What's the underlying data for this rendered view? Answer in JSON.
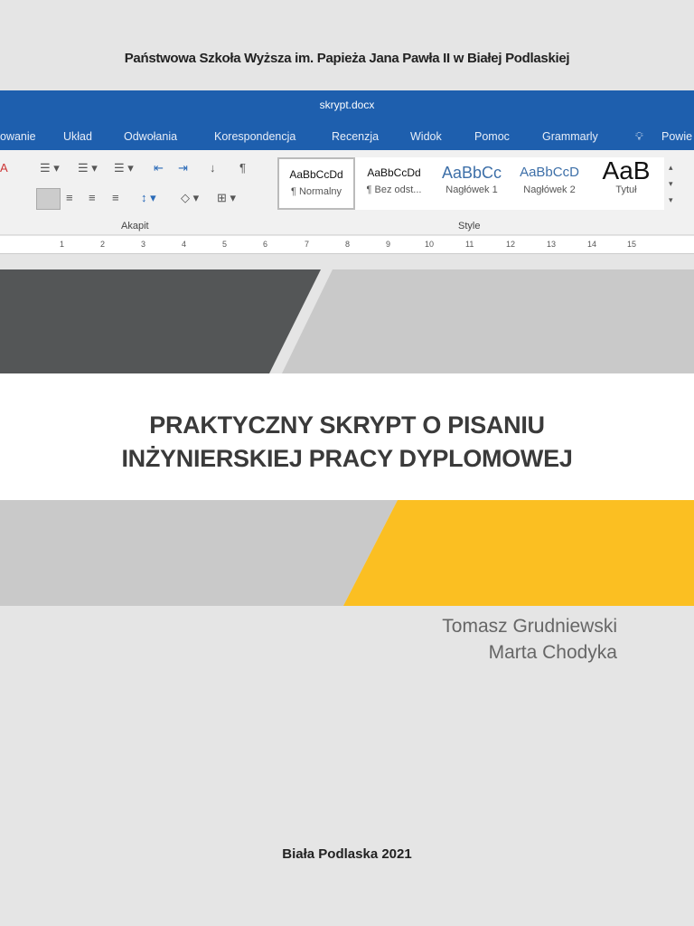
{
  "header": {
    "institution": "Państwowa Szkoła Wyższa im. Papieża Jana Pawła II w Białej Podlaskiej"
  },
  "word": {
    "filename": "skrypt.docx",
    "tabs": [
      "owanie",
      "Układ",
      "Odwołania",
      "Korespondencja",
      "Recenzja",
      "Widok",
      "Pomoc",
      "Grammarly",
      "Powie"
    ],
    "groups": {
      "paragraph": "Akapit",
      "styles": "Style"
    },
    "styles": [
      {
        "sample": "AaBbCcDd",
        "label": "¶ Normalny"
      },
      {
        "sample": "AaBbCcDd",
        "label": "¶ Bez odst..."
      },
      {
        "sample": "AaBbCc",
        "label": "Nagłówek 1"
      },
      {
        "sample": "AaBbCcD",
        "label": "Nagłówek 2"
      },
      {
        "sample": "AaB",
        "label": "Tytuł"
      }
    ],
    "ruler": [
      "1",
      "2",
      "3",
      "4",
      "5",
      "6",
      "7",
      "8",
      "9",
      "10",
      "11",
      "12",
      "13",
      "14",
      "15"
    ]
  },
  "cover": {
    "title_line1": "PRAKTYCZNY SKRYPT O PISANIU",
    "title_line2": "INŻYNIERSKIEJ PRACY DYPLOMOWEJ",
    "authors": [
      "Tomasz Grudniewski",
      "Marta Chodyka"
    ],
    "place_year": "Biała Podlaska 2021",
    "colors": {
      "dark": "#545657",
      "light": "#c9c9c9",
      "yellow": "#fbbf22",
      "blue": "#1e5fae"
    }
  }
}
